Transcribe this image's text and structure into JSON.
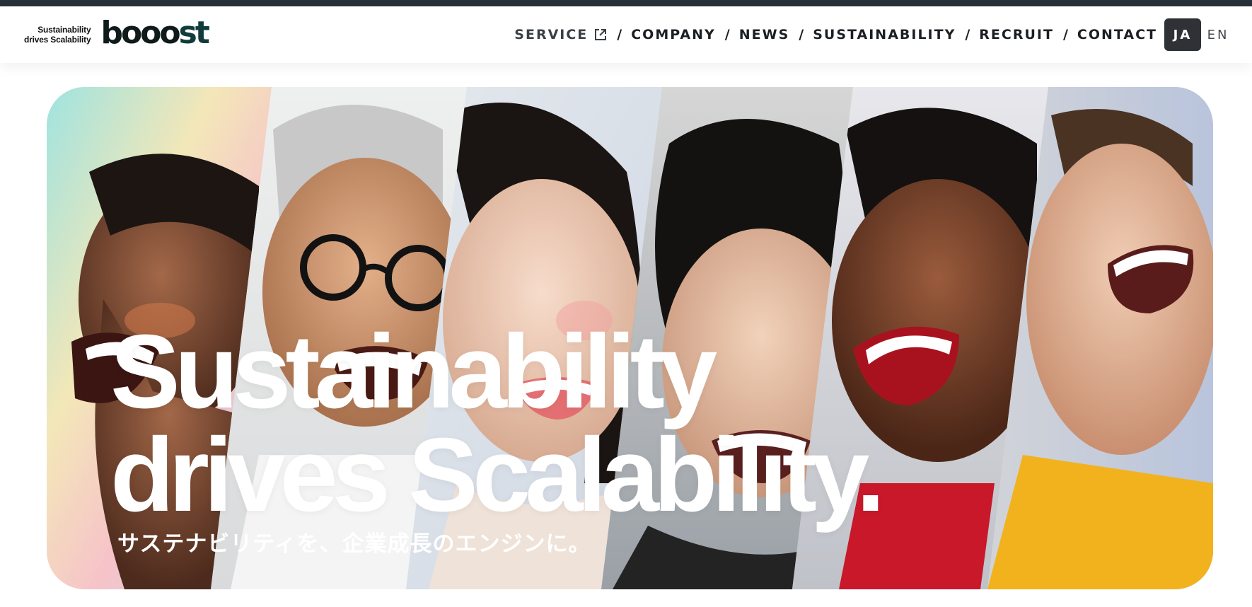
{
  "brand": {
    "tagline_line1": "Sustainability",
    "tagline_line2": "drives Scalability",
    "logo_main": "booo",
    "logo_end": "st"
  },
  "nav": {
    "items": [
      {
        "label": "SERVICE",
        "external": true
      },
      {
        "label": "COMPANY"
      },
      {
        "label": "NEWS"
      },
      {
        "label": "SUSTAINABILITY"
      },
      {
        "label": "RECRUIT"
      },
      {
        "label": "CONTACT"
      }
    ],
    "separator": "/",
    "lang": {
      "active": "JA",
      "other": "EN"
    }
  },
  "hero": {
    "headline_line1": "Sustainability",
    "headline_line2": "drives Scalability.",
    "subline": "サステナビリティを、企業成長のエンジンに。",
    "accent_colors": {
      "topbar": "#28303a",
      "lang_active_bg": "#2e3237",
      "red_top": "#c8182a",
      "yellow_top": "#f2b21e"
    }
  }
}
